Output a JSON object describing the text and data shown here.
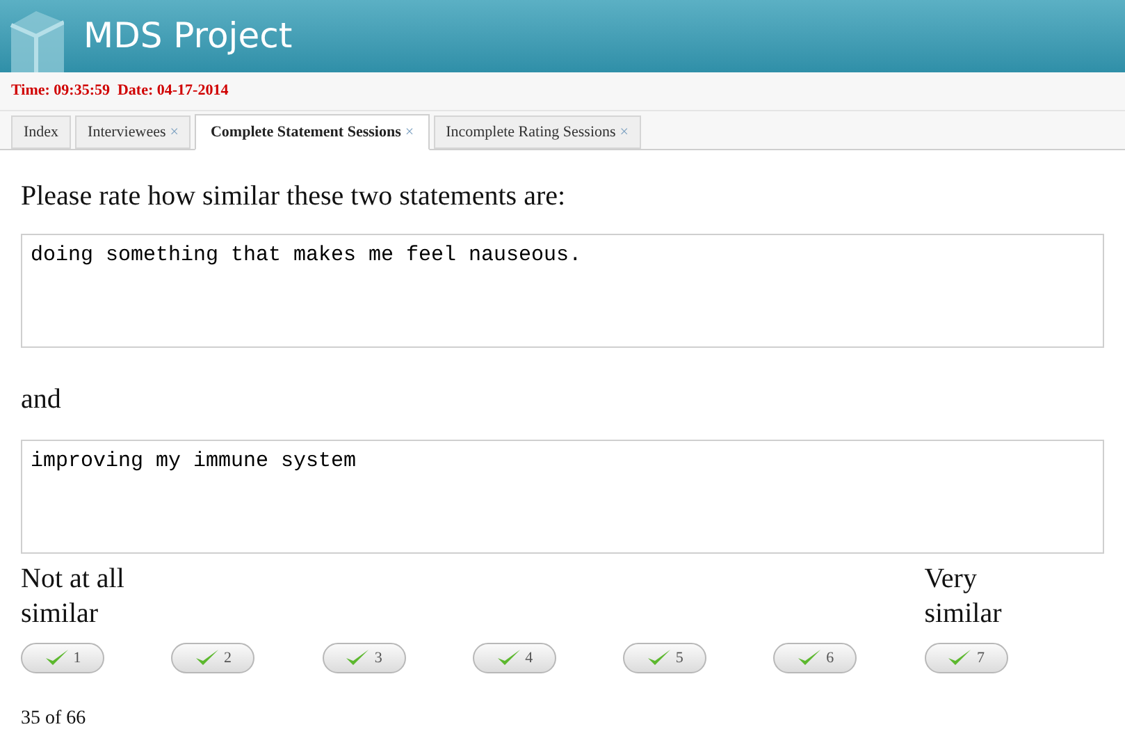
{
  "header": {
    "title": "MDS Project"
  },
  "status": {
    "text": "Time: 09:35:59  Date: 04-17-2014"
  },
  "tabs": [
    {
      "label": "Index",
      "selected": false
    },
    {
      "label": "Interviewees",
      "close": "×",
      "selected": false
    },
    {
      "label": "Complete Statement Sessions",
      "close": "×",
      "selected": true
    },
    {
      "label": "Incomplete Rating Sessions",
      "close": "×",
      "selected": false
    }
  ],
  "prompt": "Please rate how similar these two statements are:",
  "statement_1": "doing something that makes me feel nauseous.",
  "connector": "and",
  "statement_2": "improving my immune system",
  "scale": {
    "low_label": "Not at all similar",
    "high_label": "Very similar",
    "buttons": [
      {
        "label": "1"
      },
      {
        "label": "2"
      },
      {
        "label": "3"
      },
      {
        "label": "4"
      },
      {
        "label": "5"
      },
      {
        "label": "6"
      },
      {
        "label": "7"
      }
    ]
  },
  "progress": "35 of 66"
}
